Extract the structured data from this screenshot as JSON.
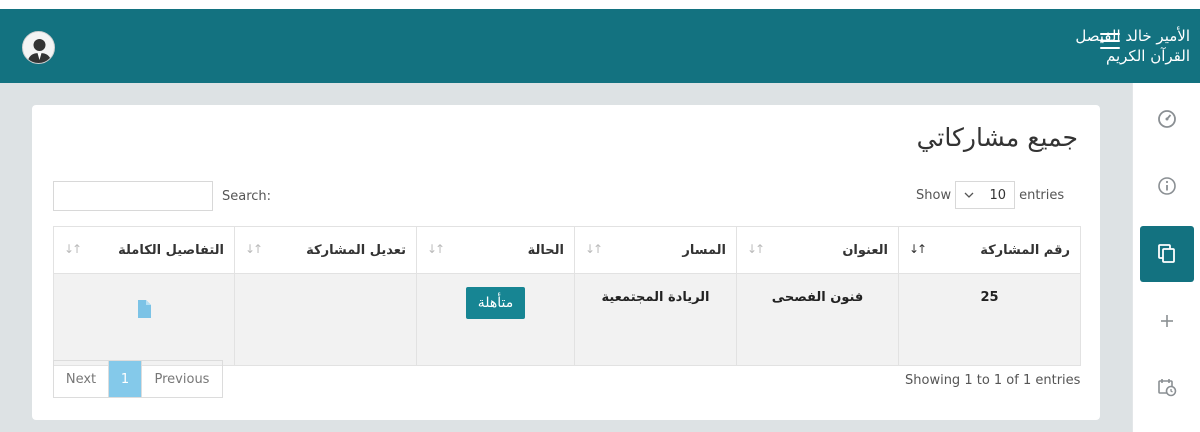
{
  "header": {
    "brand_line1": "الأمير خالد الفيصل",
    "brand_line2": "القرآن الكريم"
  },
  "sidebar": {
    "items": [
      {
        "icon": "dashboard-icon",
        "active": false
      },
      {
        "icon": "info-icon",
        "active": false
      },
      {
        "icon": "copy-icon",
        "active": true
      },
      {
        "icon": "plus-icon",
        "active": false
      },
      {
        "icon": "calendar-clock-icon",
        "active": false
      }
    ]
  },
  "page": {
    "title": "جميع مشاركاتي"
  },
  "table_controls": {
    "show_label": "Show",
    "entries_value": "10",
    "entries_label": "entries",
    "search_label": "Search:",
    "search_value": ""
  },
  "table": {
    "columns": [
      "رقم المشاركة",
      "العنوان",
      "المسار",
      "الحالة",
      "تعديل المشاركة",
      "التفاصيل الكاملة"
    ],
    "rows": [
      {
        "number": "25",
        "title": "فنون الفصحى",
        "track": "الريادة المجتمعية",
        "status": "متأهلة",
        "edit": "",
        "details_icon": "file-icon"
      }
    ]
  },
  "footer": {
    "info": "Showing 1 to 1 of 1 entries",
    "pagination": {
      "previous": "Previous",
      "current": "1",
      "next": "Next"
    }
  },
  "colors": {
    "primary": "#137280",
    "status_badge": "#178593",
    "page_active": "#84c9ea",
    "file_icon": "#7cc3e6"
  }
}
